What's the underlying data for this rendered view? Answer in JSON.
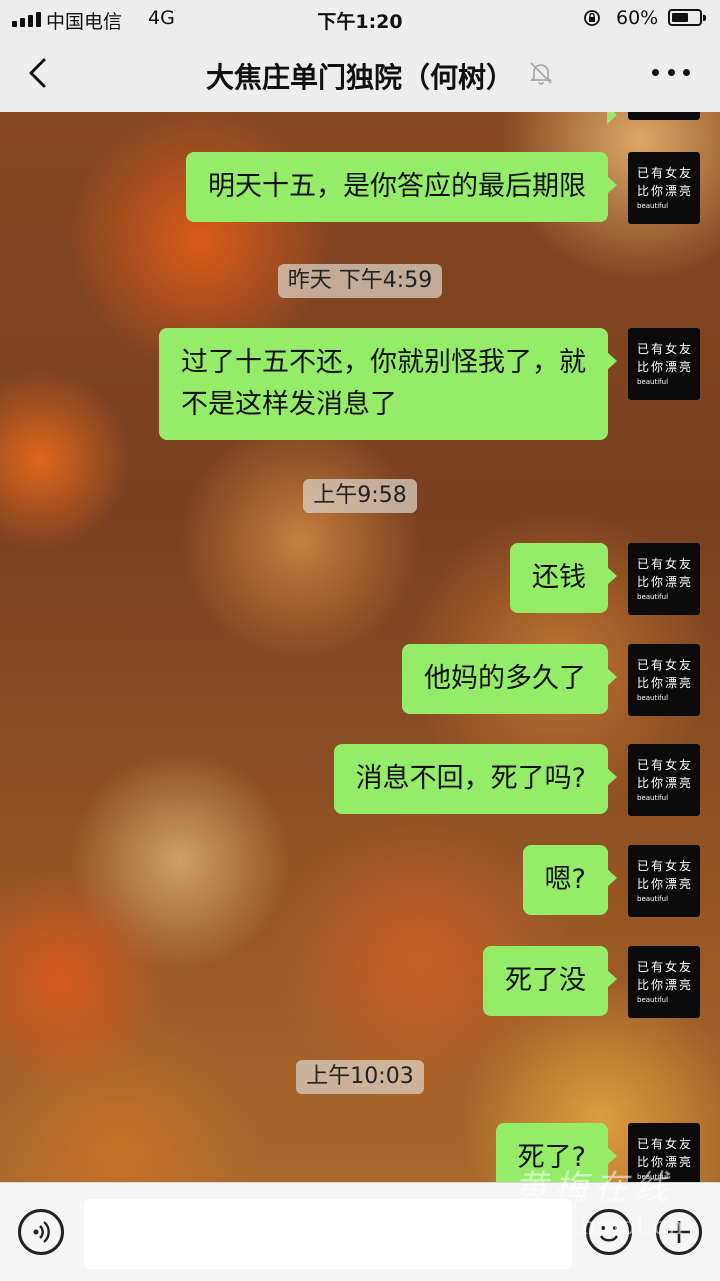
{
  "status_bar": {
    "carrier": "中国电信",
    "network": "4G",
    "time": "下午1:20",
    "battery_percent": "60%",
    "battery_level": 0.6
  },
  "header": {
    "title": "大焦庄单门独院（何树）",
    "icons": [
      "back-icon",
      "mute-bell-icon",
      "more-icon"
    ]
  },
  "avatar": {
    "line1": "已有女友",
    "line2": "比你漂亮",
    "line3": "beautiful"
  },
  "messages": [
    {
      "type": "bubble",
      "text": "明天十五，是你答应的最后期限"
    },
    {
      "type": "time",
      "text": "昨天 下午4:59"
    },
    {
      "type": "bubble",
      "line1": "过了十五不还，你就别怪我了，就",
      "line2": "不是这样发消息了"
    },
    {
      "type": "time",
      "text": "上午9:58"
    },
    {
      "type": "bubble",
      "text": "还钱"
    },
    {
      "type": "bubble",
      "text": "他妈的多久了"
    },
    {
      "type": "bubble",
      "text": "消息不回，死了吗?"
    },
    {
      "type": "bubble",
      "text": "嗯?"
    },
    {
      "type": "bubble",
      "text": "死了没"
    },
    {
      "type": "time",
      "text": "上午10:03"
    },
    {
      "type": "bubble",
      "text": "死了?"
    }
  ],
  "input_bar": {
    "icons": [
      "voice-icon",
      "emoji-icon",
      "plus-icon"
    ],
    "input_value": ""
  },
  "watermark": {
    "name": "黄梅在线",
    "url": "www.hmol.cn"
  },
  "colors": {
    "bubble": "#95ec69",
    "header_bg": "#ededed",
    "timestamp_bg": "rgba(220,210,200,0.72)"
  }
}
